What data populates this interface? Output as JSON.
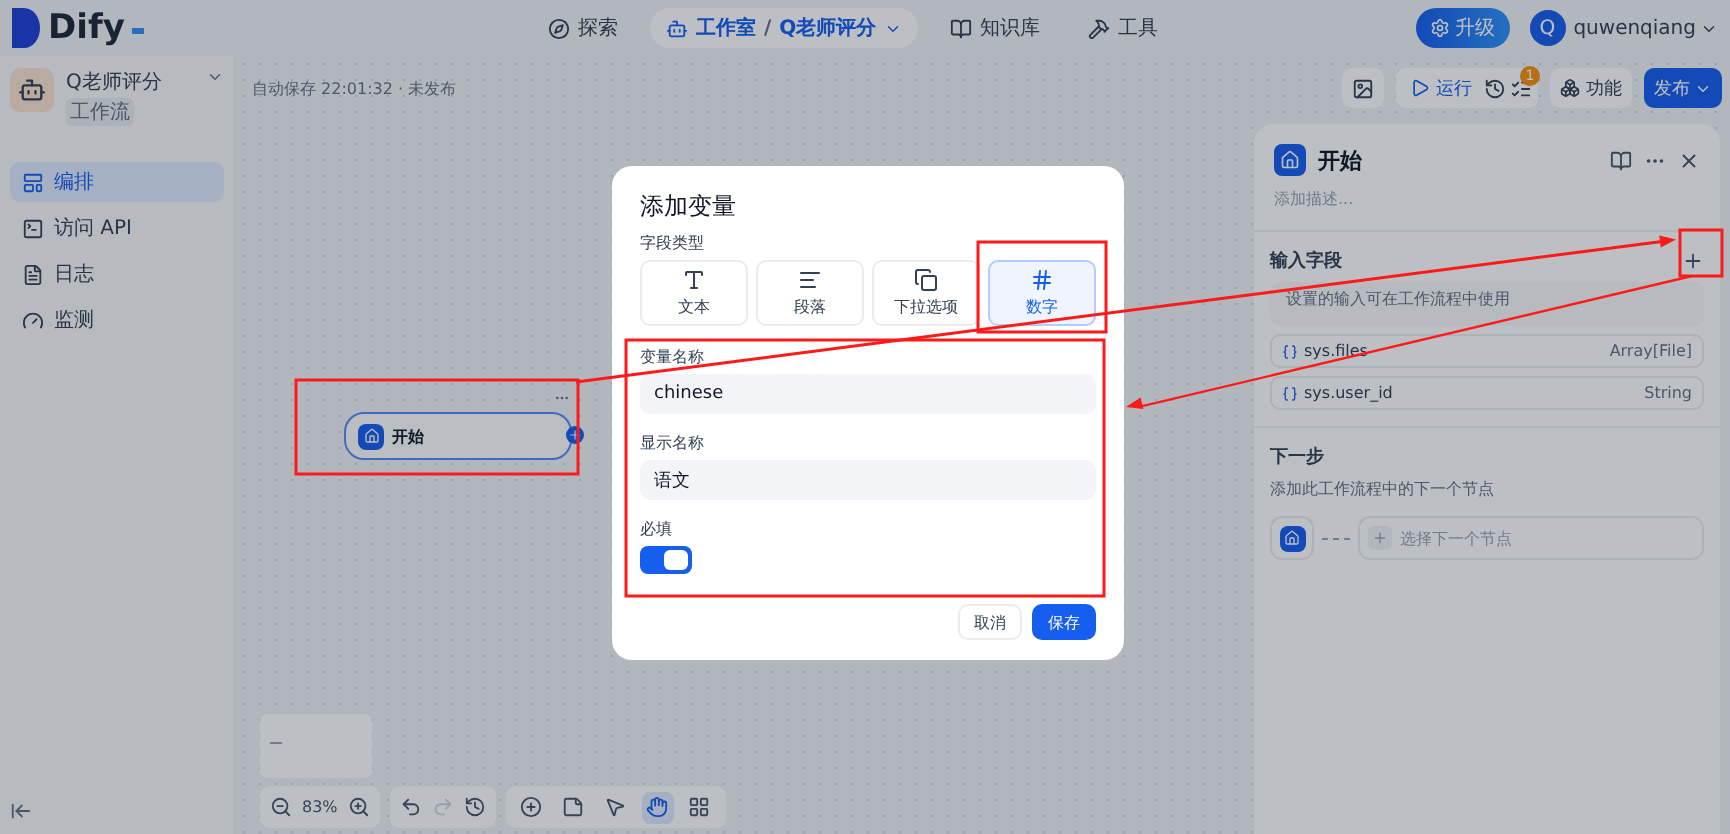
{
  "top_bar": {
    "logo": "Dify",
    "nav": [
      {
        "label": "探索",
        "kind": "explore",
        "selected": false
      },
      {
        "label": "工作室",
        "kind": "studio",
        "selected": true,
        "separator": "/",
        "app": "Q老师评分"
      },
      {
        "label": "知识库",
        "kind": "knowledge",
        "selected": false
      },
      {
        "label": "工具",
        "kind": "tools",
        "selected": false
      }
    ],
    "upgrade": "升级",
    "avatar": "Q",
    "user": "quwenqiang"
  },
  "sidebar": {
    "app_name": "Q老师评分",
    "app_type": "工作流",
    "items": [
      {
        "label": "编排",
        "kind": "orchestrate",
        "selected": true
      },
      {
        "label": "访问 API",
        "kind": "api",
        "selected": false
      },
      {
        "label": "日志",
        "kind": "logs",
        "selected": false
      },
      {
        "label": "监测",
        "kind": "monitor",
        "selected": false
      }
    ]
  },
  "canvas": {
    "autosave": "自动保存 22:01:32 · 未发布",
    "run": "运行",
    "checklist_badge": "1",
    "features": "功能",
    "publish": "发布",
    "node": {
      "title": "开始"
    },
    "zoom": "83%",
    "tools": [
      {
        "kind": "add",
        "selected": false
      },
      {
        "kind": "note",
        "selected": false
      },
      {
        "kind": "pointer",
        "selected": false
      },
      {
        "kind": "hand",
        "selected": true
      },
      {
        "kind": "organize",
        "selected": false
      }
    ]
  },
  "panel": {
    "title": "开始",
    "description_placeholder": "添加描述...",
    "inputs_title": "输入字段",
    "inputs_hint": "设置的输入可在工作流程中使用",
    "variables": [
      {
        "name": "sys.files",
        "type": "Array[File]"
      },
      {
        "name": "sys.user_id",
        "type": "String"
      }
    ],
    "next_title": "下一步",
    "next_description": "添加此工作流程中的下一个节点",
    "next_placeholder": "选择下一个节点"
  },
  "modal": {
    "title": "添加变量",
    "type_label": "字段类型",
    "types": [
      {
        "label": "文本",
        "kind": "text",
        "selected": false
      },
      {
        "label": "段落",
        "kind": "paragraph",
        "selected": false
      },
      {
        "label": "下拉选项",
        "kind": "select",
        "selected": false
      },
      {
        "label": "数字",
        "kind": "number",
        "selected": true
      }
    ],
    "fields": [
      {
        "label": "变量名称",
        "value": "chinese"
      },
      {
        "label": "显示名称",
        "value": "语文"
      }
    ],
    "required_label": "必填",
    "required": true,
    "cancel": "取消",
    "save": "保存"
  }
}
